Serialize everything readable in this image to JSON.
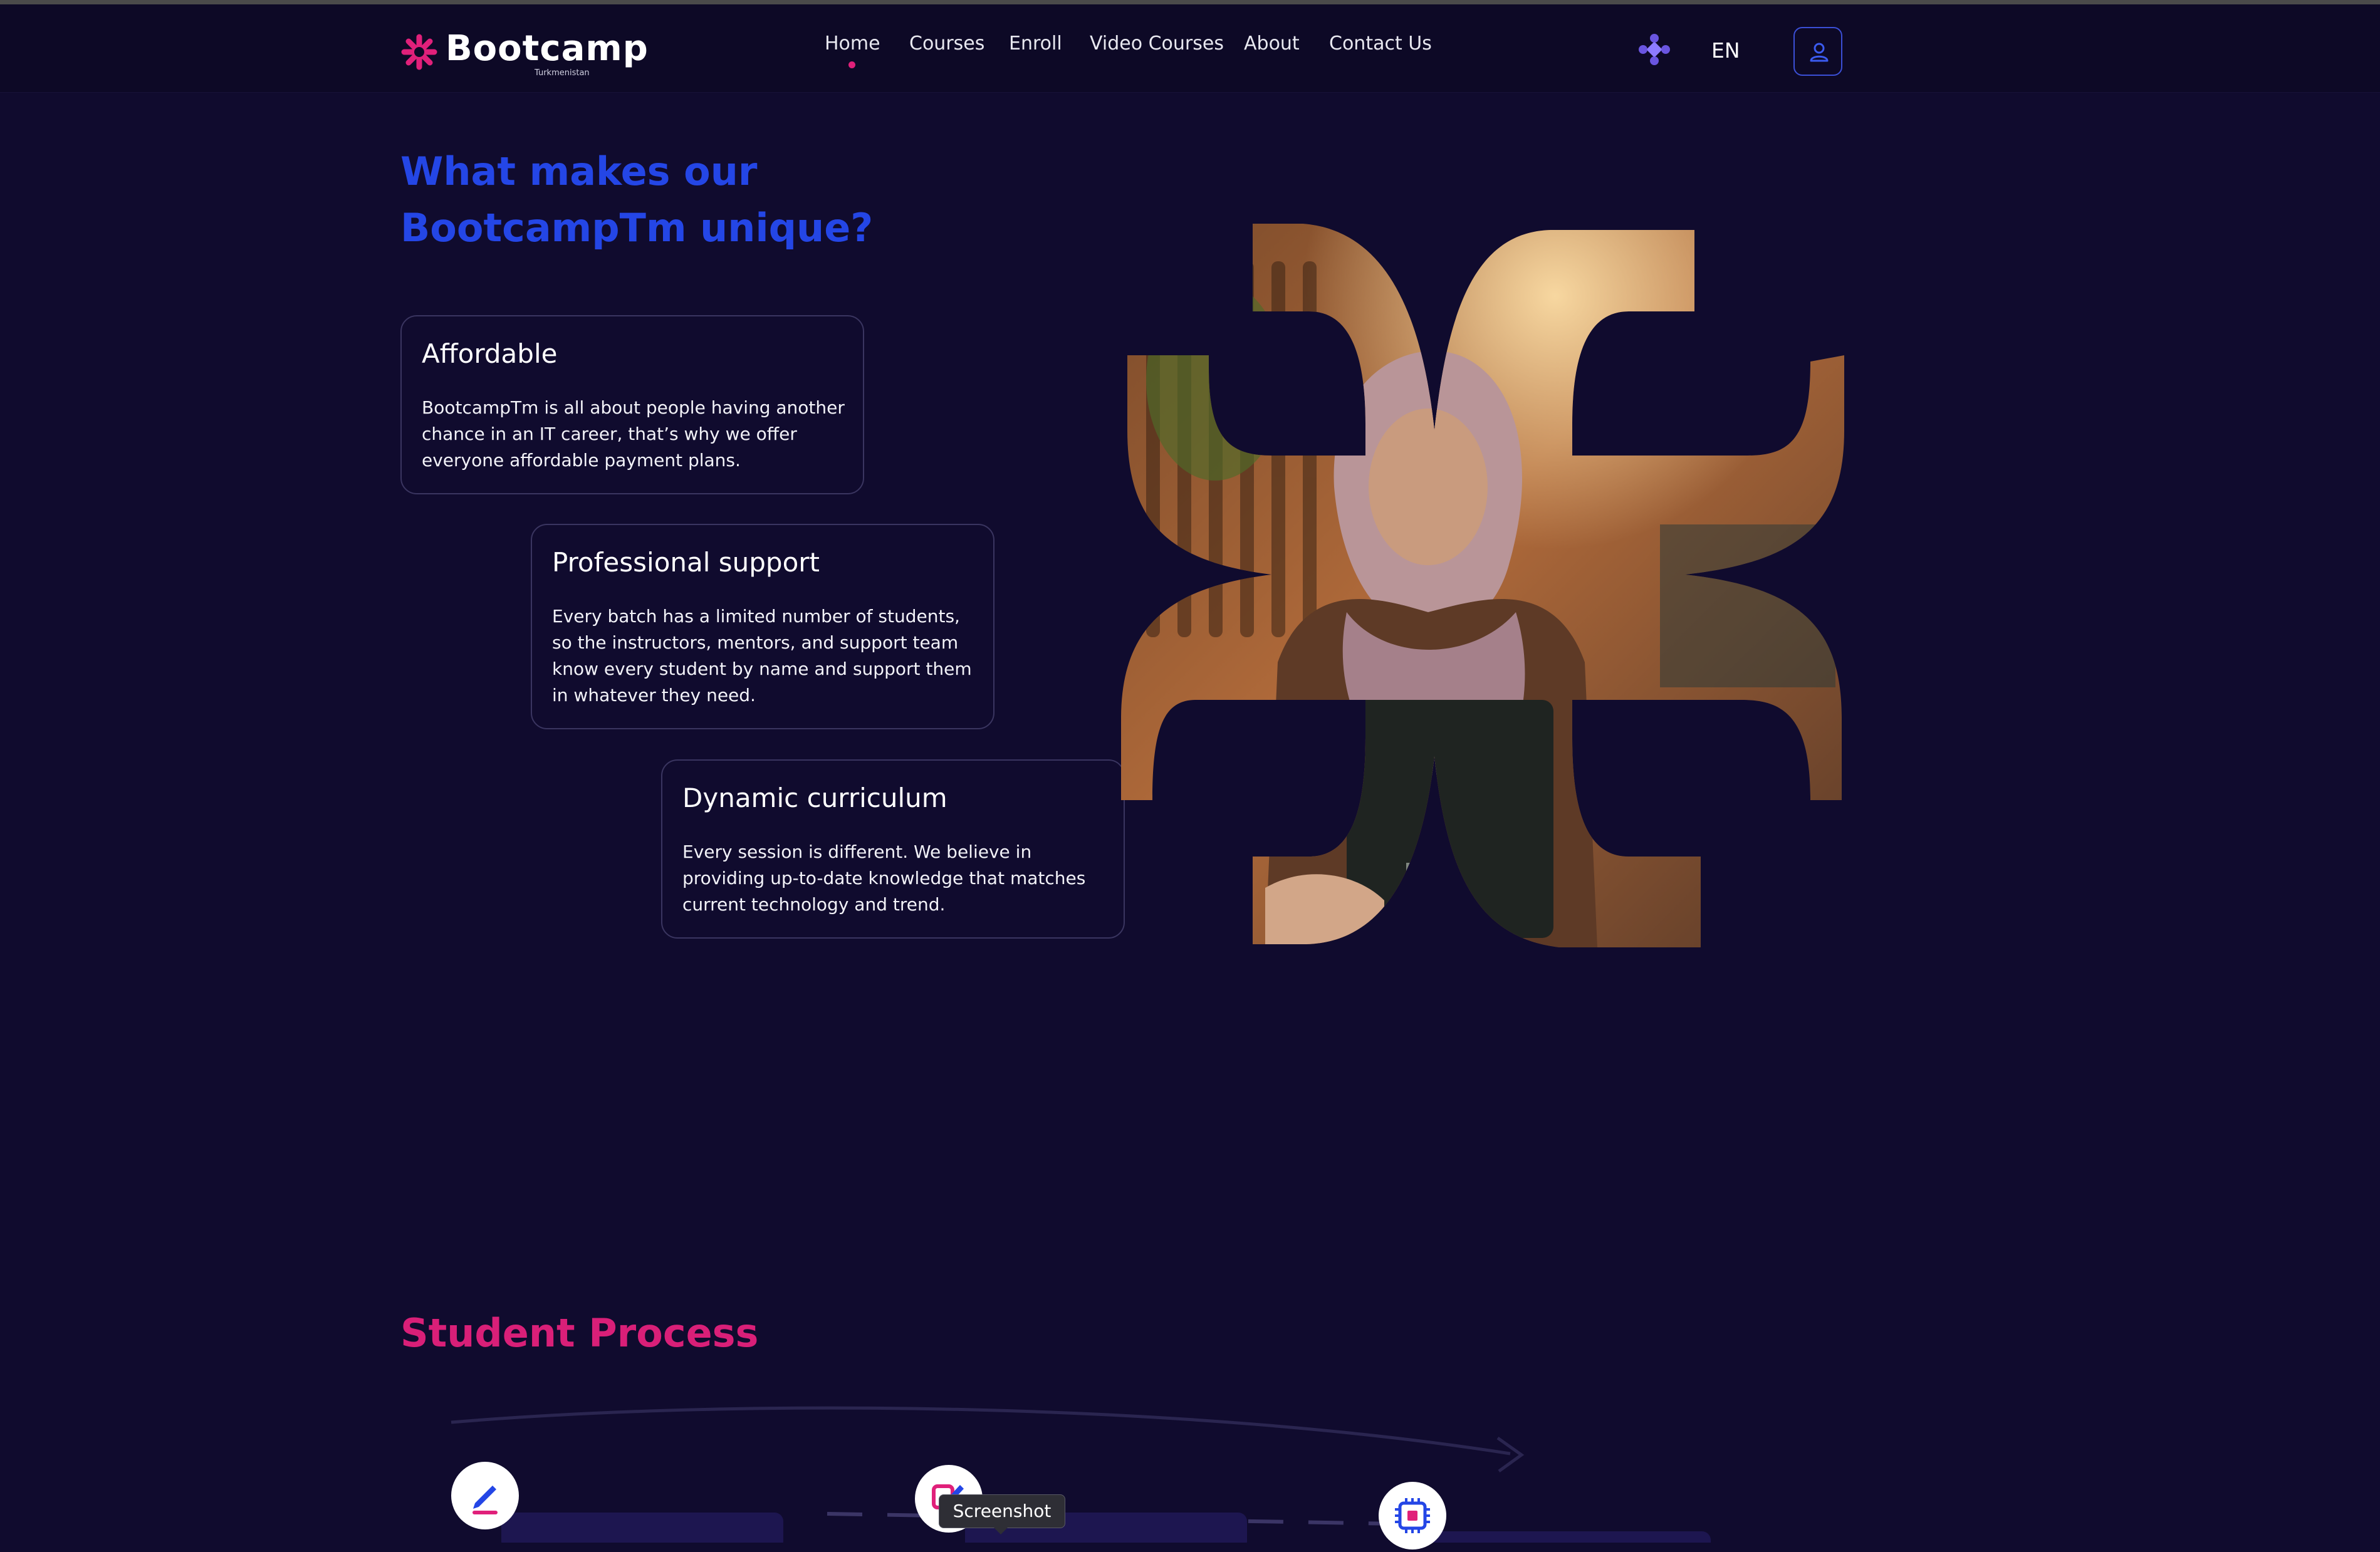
{
  "header": {
    "logo_text": "Bootcamp",
    "logo_subtext": "Turkmenistan",
    "nav": [
      {
        "label": "Home",
        "active": true
      },
      {
        "label": "Courses"
      },
      {
        "label": "Enroll"
      },
      {
        "label": "Video Courses"
      },
      {
        "label": "About"
      },
      {
        "label": "Contact Us"
      }
    ],
    "apps_icon": "apps-grid-icon",
    "language": "EN",
    "user_icon": "user-icon"
  },
  "unique": {
    "title_line1": "What makes our",
    "title_line2": "BootcampTm unique?",
    "cards": [
      {
        "title": "Affordable",
        "text": "BootcampTm is all about people having another chance in an IT career, that’s why we offer everyone affordable payment plans."
      },
      {
        "title": "Professional support",
        "text": "Every batch has a limited number of students, so the instructors, mentors, and support team know every student by name and support them in whatever they need."
      },
      {
        "title": "Dynamic curriculum",
        "text": "Every session is different. We believe in providing up-to-date knowledge that matches current technology and trend."
      }
    ]
  },
  "process": {
    "title": "Student Process",
    "steps": [
      {
        "icon": "pen-icon"
      },
      {
        "icon": "edit-check-icon"
      },
      {
        "icon": "chip-icon"
      }
    ]
  },
  "tooltip": {
    "label": "Screenshot"
  },
  "colors": {
    "background": "#100b2e",
    "accent_blue": "#2446e6",
    "accent_pink": "#d91f78"
  }
}
